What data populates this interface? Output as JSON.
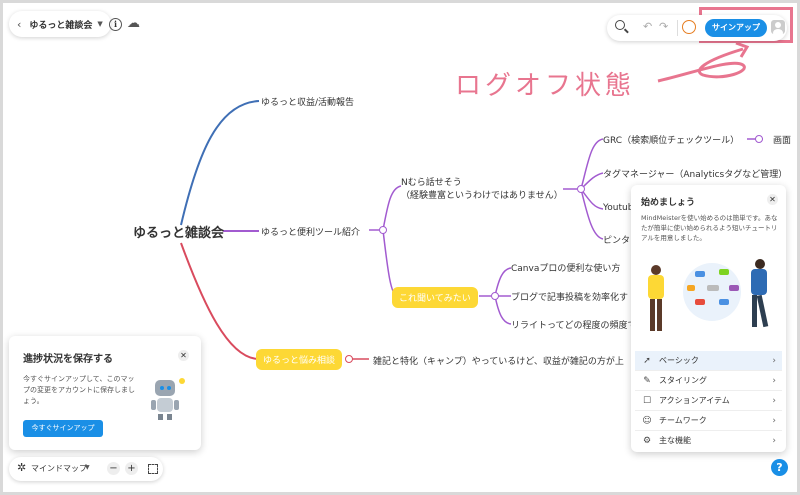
{
  "header": {
    "back_icon": "chevron-left-icon",
    "title": "ゆるっと雑談会",
    "dropdown_icon": "chevron-down-icon",
    "info_icon": "info-icon",
    "cloud_icon": "cloud-upload-icon",
    "search_icon": "search-icon",
    "undo_icon": "undo-icon",
    "redo_icon": "redo-icon",
    "signup_label": "サインアップ",
    "avatar_icon": "user-avatar-icon"
  },
  "annotation": {
    "text": "ログオフ状態",
    "color": "#e8758f"
  },
  "mindmap": {
    "root": "ゆるっと雑談会",
    "branches": {
      "b1": "ゆるっと収益/活動報告",
      "b2": "ゆるっと便利ツール紹介",
      "b3": "ゆるっと悩み相談"
    },
    "sub": {
      "n_line1": "Nむら話せそう",
      "n_line2": "（経験豊富というわけではありません）",
      "yellow": "これ聞いてみたい",
      "grc": "GRC（検索順位チェックツール）",
      "grc_child": "画面",
      "tag": "タグマネージャー（Analyticsタグなど管理）",
      "youtube": "Youtube",
      "pinta": "ピンタ",
      "canva": "Canvaプロの便利な使い方",
      "blog": "ブログで記事投稿を効率化す",
      "rewrite": "リライトってどの程度の頻度で",
      "worry": "雑記と特化（キャンプ）やっているけど、収益が雑記の方が上"
    },
    "colors": {
      "blue": "#3f6fb5",
      "purple": "#a25bd0",
      "red": "#d94b5e",
      "yellow": "#fdd835"
    }
  },
  "getting_started": {
    "title": "始めましょう",
    "close_icon": "close-icon",
    "description": "MindMeisterを使い始めるのは簡単です。あなたが簡単に使い始められるよう短いチュートリアルを用意しました。",
    "items": [
      {
        "icon": "rocket-icon",
        "label": "ベーシック"
      },
      {
        "icon": "brush-icon",
        "label": "スタイリング"
      },
      {
        "icon": "action-icon",
        "label": "アクションアイテム"
      },
      {
        "icon": "team-icon",
        "label": "チームワーク"
      },
      {
        "icon": "settings-icon",
        "label": "主な機能"
      }
    ],
    "chevron_icon": "chevron-right-icon"
  },
  "save_panel": {
    "title": "進捗状況を保存する",
    "close_icon": "close-icon",
    "description": "今すぐサインアップして、このマップの変更をアカウントに保存しましょう。",
    "button": "今すぐサインアップ",
    "robot_icon": "robot-icon"
  },
  "bottom_bar": {
    "mode_icon": "mindmap-icon",
    "mode_label": "マインドマップ",
    "mode_dropdown_icon": "chevron-down-icon",
    "zoom_out": "−",
    "zoom_in": "+",
    "fit_icon": "fit-screen-icon",
    "help_icon": "help-icon"
  }
}
